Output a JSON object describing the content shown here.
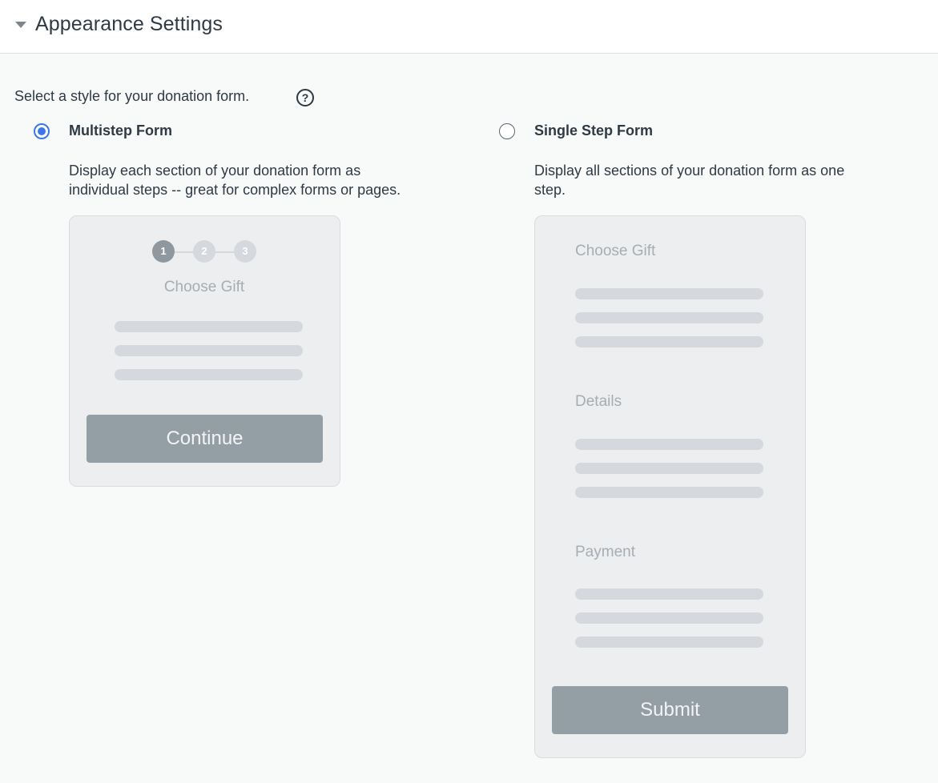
{
  "header": {
    "title": "Appearance Settings"
  },
  "prompt": {
    "text": "Select a style for your donation form.",
    "help_glyph": "?"
  },
  "options": {
    "multistep": {
      "selected": true,
      "title": "Multistep Form",
      "description_line1": "Display each section of your donation form as",
      "description_line2": "individual steps -- great for complex forms or pages.",
      "preview": {
        "steps": [
          "1",
          "2",
          "3"
        ],
        "active_step": "1",
        "section_label": "Choose Gift",
        "button_label": "Continue"
      }
    },
    "singlestep": {
      "selected": false,
      "title": "Single Step Form",
      "description_line1": "Display all sections of your donation form as one",
      "description_line2": "step.",
      "preview": {
        "sections": [
          "Choose Gift",
          "Details",
          "Payment"
        ],
        "button_label": "Submit"
      }
    }
  },
  "colors": {
    "accent": "#3a78e4",
    "preview_button": "#939ea5",
    "preview_bg": "#eceef0"
  }
}
